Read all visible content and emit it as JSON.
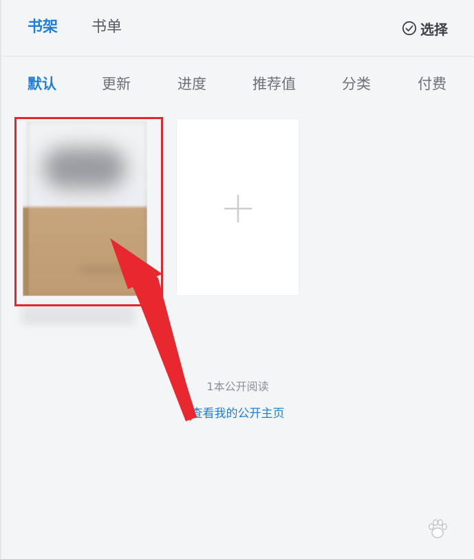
{
  "header": {
    "tabs": [
      {
        "label": "书架",
        "active": true
      },
      {
        "label": "书单",
        "active": false
      }
    ],
    "select_label": "选择"
  },
  "sort_options": [
    "默认",
    "更新",
    "进度",
    "推荐值",
    "分类",
    "付费"
  ],
  "sort_active_index": 0,
  "public": {
    "count_text": "1本公开阅读",
    "link_text": "查看我的公开主页"
  },
  "colors": {
    "accent": "#1f7fd8",
    "annotation_red": "#e2262c"
  },
  "icons": {
    "select": "check-circle-icon",
    "add": "plus-icon"
  }
}
